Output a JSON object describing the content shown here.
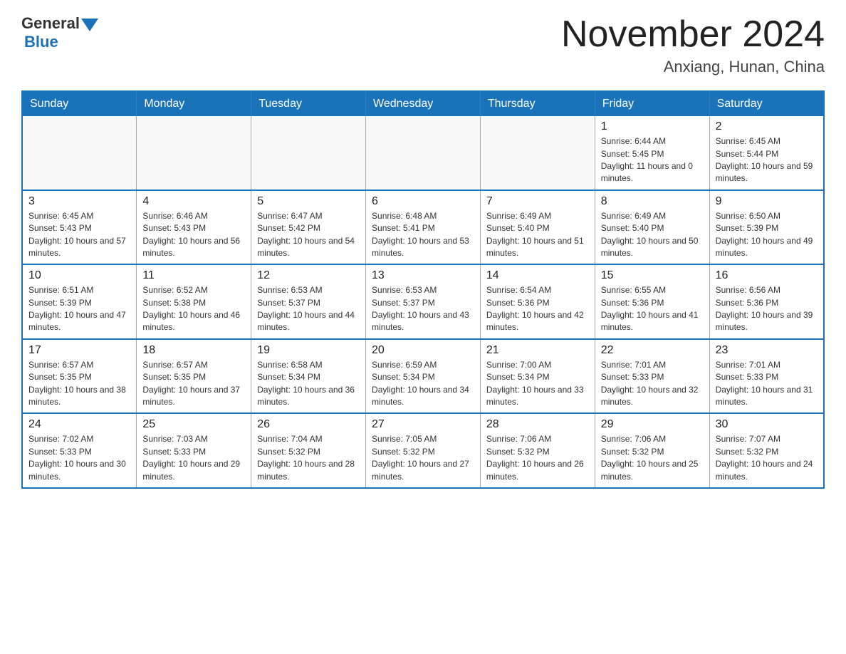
{
  "header": {
    "logo_general": "General",
    "logo_blue": "Blue",
    "month_title": "November 2024",
    "location": "Anxiang, Hunan, China"
  },
  "days_of_week": [
    "Sunday",
    "Monday",
    "Tuesday",
    "Wednesday",
    "Thursday",
    "Friday",
    "Saturday"
  ],
  "weeks": [
    [
      {
        "day": "",
        "info": ""
      },
      {
        "day": "",
        "info": ""
      },
      {
        "day": "",
        "info": ""
      },
      {
        "day": "",
        "info": ""
      },
      {
        "day": "",
        "info": ""
      },
      {
        "day": "1",
        "info": "Sunrise: 6:44 AM\nSunset: 5:45 PM\nDaylight: 11 hours and 0 minutes."
      },
      {
        "day": "2",
        "info": "Sunrise: 6:45 AM\nSunset: 5:44 PM\nDaylight: 10 hours and 59 minutes."
      }
    ],
    [
      {
        "day": "3",
        "info": "Sunrise: 6:45 AM\nSunset: 5:43 PM\nDaylight: 10 hours and 57 minutes."
      },
      {
        "day": "4",
        "info": "Sunrise: 6:46 AM\nSunset: 5:43 PM\nDaylight: 10 hours and 56 minutes."
      },
      {
        "day": "5",
        "info": "Sunrise: 6:47 AM\nSunset: 5:42 PM\nDaylight: 10 hours and 54 minutes."
      },
      {
        "day": "6",
        "info": "Sunrise: 6:48 AM\nSunset: 5:41 PM\nDaylight: 10 hours and 53 minutes."
      },
      {
        "day": "7",
        "info": "Sunrise: 6:49 AM\nSunset: 5:40 PM\nDaylight: 10 hours and 51 minutes."
      },
      {
        "day": "8",
        "info": "Sunrise: 6:49 AM\nSunset: 5:40 PM\nDaylight: 10 hours and 50 minutes."
      },
      {
        "day": "9",
        "info": "Sunrise: 6:50 AM\nSunset: 5:39 PM\nDaylight: 10 hours and 49 minutes."
      }
    ],
    [
      {
        "day": "10",
        "info": "Sunrise: 6:51 AM\nSunset: 5:39 PM\nDaylight: 10 hours and 47 minutes."
      },
      {
        "day": "11",
        "info": "Sunrise: 6:52 AM\nSunset: 5:38 PM\nDaylight: 10 hours and 46 minutes."
      },
      {
        "day": "12",
        "info": "Sunrise: 6:53 AM\nSunset: 5:37 PM\nDaylight: 10 hours and 44 minutes."
      },
      {
        "day": "13",
        "info": "Sunrise: 6:53 AM\nSunset: 5:37 PM\nDaylight: 10 hours and 43 minutes."
      },
      {
        "day": "14",
        "info": "Sunrise: 6:54 AM\nSunset: 5:36 PM\nDaylight: 10 hours and 42 minutes."
      },
      {
        "day": "15",
        "info": "Sunrise: 6:55 AM\nSunset: 5:36 PM\nDaylight: 10 hours and 41 minutes."
      },
      {
        "day": "16",
        "info": "Sunrise: 6:56 AM\nSunset: 5:36 PM\nDaylight: 10 hours and 39 minutes."
      }
    ],
    [
      {
        "day": "17",
        "info": "Sunrise: 6:57 AM\nSunset: 5:35 PM\nDaylight: 10 hours and 38 minutes."
      },
      {
        "day": "18",
        "info": "Sunrise: 6:57 AM\nSunset: 5:35 PM\nDaylight: 10 hours and 37 minutes."
      },
      {
        "day": "19",
        "info": "Sunrise: 6:58 AM\nSunset: 5:34 PM\nDaylight: 10 hours and 36 minutes."
      },
      {
        "day": "20",
        "info": "Sunrise: 6:59 AM\nSunset: 5:34 PM\nDaylight: 10 hours and 34 minutes."
      },
      {
        "day": "21",
        "info": "Sunrise: 7:00 AM\nSunset: 5:34 PM\nDaylight: 10 hours and 33 minutes."
      },
      {
        "day": "22",
        "info": "Sunrise: 7:01 AM\nSunset: 5:33 PM\nDaylight: 10 hours and 32 minutes."
      },
      {
        "day": "23",
        "info": "Sunrise: 7:01 AM\nSunset: 5:33 PM\nDaylight: 10 hours and 31 minutes."
      }
    ],
    [
      {
        "day": "24",
        "info": "Sunrise: 7:02 AM\nSunset: 5:33 PM\nDaylight: 10 hours and 30 minutes."
      },
      {
        "day": "25",
        "info": "Sunrise: 7:03 AM\nSunset: 5:33 PM\nDaylight: 10 hours and 29 minutes."
      },
      {
        "day": "26",
        "info": "Sunrise: 7:04 AM\nSunset: 5:32 PM\nDaylight: 10 hours and 28 minutes."
      },
      {
        "day": "27",
        "info": "Sunrise: 7:05 AM\nSunset: 5:32 PM\nDaylight: 10 hours and 27 minutes."
      },
      {
        "day": "28",
        "info": "Sunrise: 7:06 AM\nSunset: 5:32 PM\nDaylight: 10 hours and 26 minutes."
      },
      {
        "day": "29",
        "info": "Sunrise: 7:06 AM\nSunset: 5:32 PM\nDaylight: 10 hours and 25 minutes."
      },
      {
        "day": "30",
        "info": "Sunrise: 7:07 AM\nSunset: 5:32 PM\nDaylight: 10 hours and 24 minutes."
      }
    ]
  ]
}
